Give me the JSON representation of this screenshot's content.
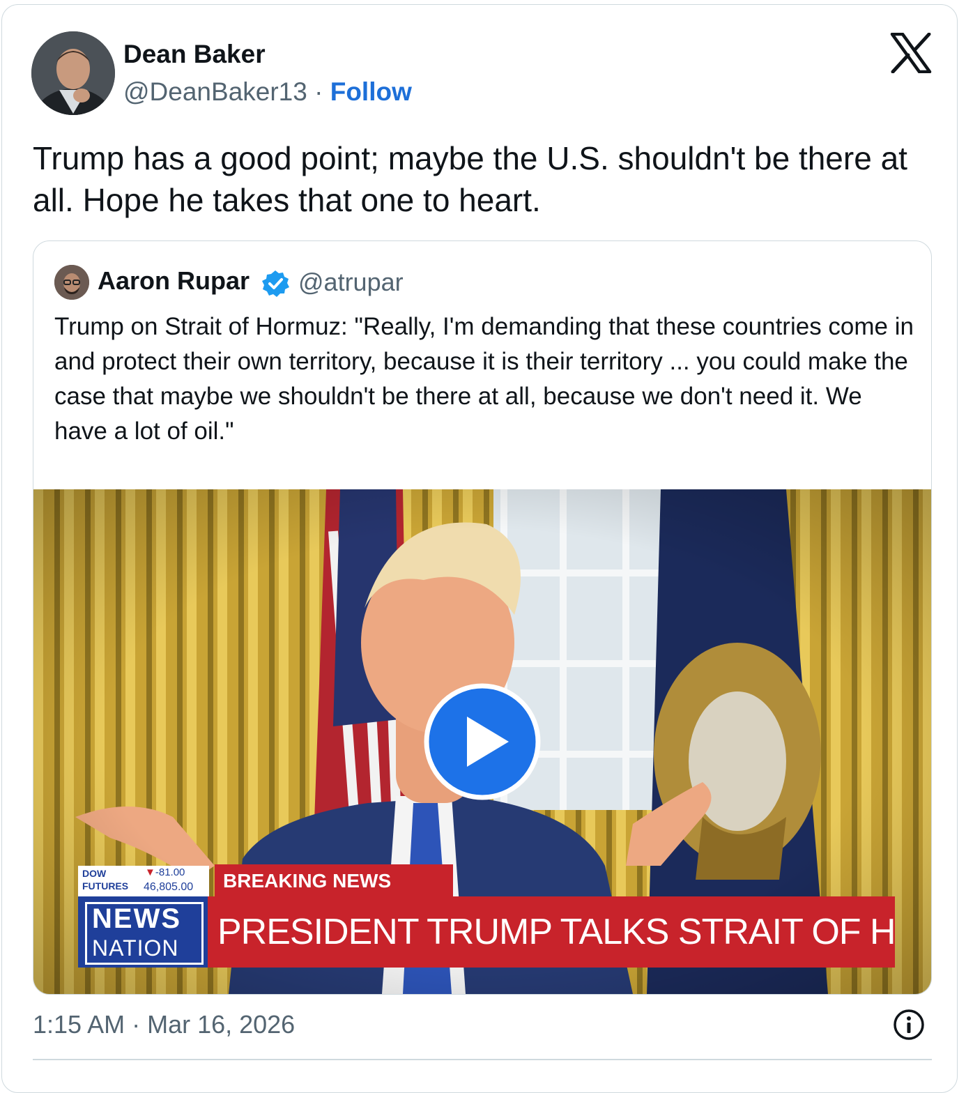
{
  "author": {
    "name": "Dean Baker",
    "handle": "@DeanBaker13",
    "separator": "·",
    "follow_label": "Follow"
  },
  "tweet": {
    "text": "Trump has a good point; maybe the U.S. shouldn't be there at all. Hope he takes that one to heart."
  },
  "quoted": {
    "name": "Aaron Rupar",
    "handle": "@atrupar",
    "verified": true,
    "text": "Trump on Strait of Hormuz: \"Really, I'm demanding that these countries come in and protect their own territory, because it is their territory ... you could make the case that maybe we shouldn't be there at all, because we don't need it. We have a lot of oil.\"",
    "media": {
      "type": "video",
      "dow_label_1": "DOW",
      "dow_label_2": "FUTURES",
      "dow_change": "-81.00",
      "dow_value": "46,805.00",
      "breaking_label": "BREAKING NEWS",
      "network_1": "NEWS",
      "network_2": "NATION",
      "headline": "PRESIDENT TRUMP TALKS STRAIT OF HORMUZ"
    }
  },
  "footer": {
    "timestamp": "1:15 AM · Mar 16, 2026"
  },
  "colors": {
    "accent": "#1d6fd8",
    "verified": "#1d9bf0",
    "breaking_red": "#c8232b",
    "nation_blue": "#1f3f9a"
  },
  "icons": [
    "x-logo-icon",
    "verified-badge-icon",
    "play-icon",
    "info-icon"
  ]
}
